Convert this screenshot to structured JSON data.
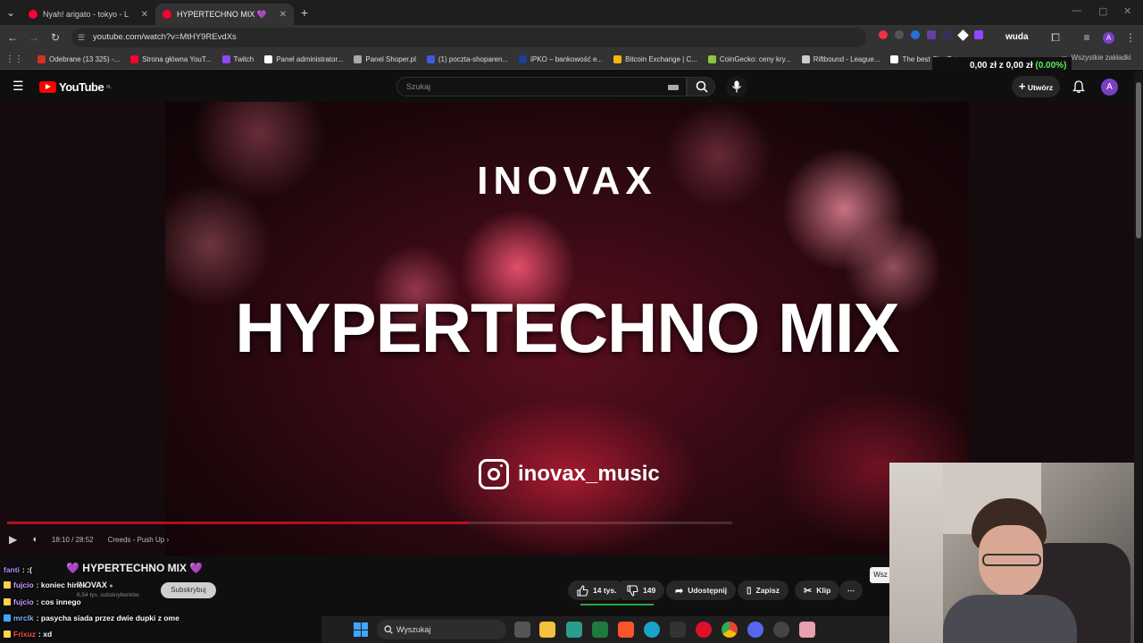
{
  "browser": {
    "tabs": [
      {
        "title": "Nyah! arigato - tokyo - Leat'eq",
        "active": false
      },
      {
        "title": "HYPERTECHNO MIX 💜 - Yo",
        "active": true
      }
    ],
    "new_tab": "+",
    "url": "youtube.com/watch?v=MtHY9REvdXs",
    "bookmarks": [
      {
        "label": "Odebrane (13 325) -...",
        "color": "#d93025"
      },
      {
        "label": "Strona główna YouT...",
        "color": "#ff0033"
      },
      {
        "label": "Twitch",
        "color": "#9146ff"
      },
      {
        "label": "Panel administrator...",
        "color": "#ffffff"
      },
      {
        "label": "Panel Shoper.pl",
        "color": "#aaaaaa"
      },
      {
        "label": "(1) poczta-shoparen...",
        "color": "#3b5bdb"
      },
      {
        "label": "iPKO – bankowość e...",
        "color": "#1c3f94"
      },
      {
        "label": "Bitcoin Exchange | C...",
        "color": "#f0b90b"
      },
      {
        "label": "CoinGecko: ceny kry...",
        "color": "#8dc63f"
      },
      {
        "label": "Riftbound - League...",
        "color": "#cccccc"
      },
      {
        "label": "The best ChatBot an...",
        "color": "#ffffff"
      }
    ],
    "all_bookmarks": "Wszystkie zakładki",
    "extension_label": "wuda",
    "wallet_text": "0,00 zł z 0,00 zł",
    "wallet_pct": "(0.00%)",
    "profile_initial": "A"
  },
  "youtube": {
    "logo": "YouTube",
    "logo_region": "PL",
    "search_placeholder": "Szukaj",
    "create_label": "Utwórz",
    "avatar_initial": "A"
  },
  "video": {
    "brand": "INOVAX",
    "headline": "HYPERTECHNO MIX",
    "instagram": "inovax_music",
    "time": "18:10 / 28:52",
    "chapter": "Creeds - Push Up",
    "progress": 0.637
  },
  "info": {
    "title": "💜 HYPERTECHNO MIX 💜",
    "channel": "INOVAX",
    "subscribers": "6,54 tys. subskrybentów",
    "subscribe": "Subskrybuj",
    "likes": "14 tys.",
    "dislikes": "149",
    "share": "Udostępnij",
    "save": "Zapisz",
    "clip": "Klip",
    "more": "⋯",
    "side_button": "Wsz"
  },
  "chat": [
    {
      "user": "fanti",
      "text": ": :(",
      "color": "#b58cff"
    },
    {
      "user": "fujcio",
      "text": ": koniec hinek",
      "color": "#c9a0ff"
    },
    {
      "user": "fujcio",
      "text": ": cos innego",
      "color": "#c9a0ff"
    },
    {
      "user": "mrclk",
      "text": ": pasycha siada przez dwie dupki z ome",
      "color": "#7fb3ff"
    },
    {
      "user": "Frixuz",
      "text": ": xd",
      "color": "#ff4d4d"
    }
  ],
  "taskbar": {
    "search": "Wyszukaj"
  }
}
